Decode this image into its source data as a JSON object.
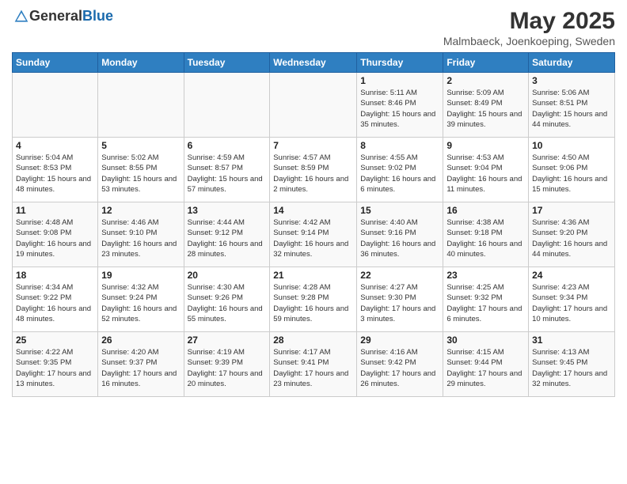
{
  "header": {
    "logo_general": "General",
    "logo_blue": "Blue",
    "title": "May 2025",
    "subtitle": "Malmbaeck, Joenkoeping, Sweden"
  },
  "days_of_week": [
    "Sunday",
    "Monday",
    "Tuesday",
    "Wednesday",
    "Thursday",
    "Friday",
    "Saturday"
  ],
  "weeks": [
    [
      {
        "day": "",
        "info": ""
      },
      {
        "day": "",
        "info": ""
      },
      {
        "day": "",
        "info": ""
      },
      {
        "day": "",
        "info": ""
      },
      {
        "day": "1",
        "info": "Sunrise: 5:11 AM\nSunset: 8:46 PM\nDaylight: 15 hours and 35 minutes."
      },
      {
        "day": "2",
        "info": "Sunrise: 5:09 AM\nSunset: 8:49 PM\nDaylight: 15 hours and 39 minutes."
      },
      {
        "day": "3",
        "info": "Sunrise: 5:06 AM\nSunset: 8:51 PM\nDaylight: 15 hours and 44 minutes."
      }
    ],
    [
      {
        "day": "4",
        "info": "Sunrise: 5:04 AM\nSunset: 8:53 PM\nDaylight: 15 hours and 48 minutes."
      },
      {
        "day": "5",
        "info": "Sunrise: 5:02 AM\nSunset: 8:55 PM\nDaylight: 15 hours and 53 minutes."
      },
      {
        "day": "6",
        "info": "Sunrise: 4:59 AM\nSunset: 8:57 PM\nDaylight: 15 hours and 57 minutes."
      },
      {
        "day": "7",
        "info": "Sunrise: 4:57 AM\nSunset: 8:59 PM\nDaylight: 16 hours and 2 minutes."
      },
      {
        "day": "8",
        "info": "Sunrise: 4:55 AM\nSunset: 9:02 PM\nDaylight: 16 hours and 6 minutes."
      },
      {
        "day": "9",
        "info": "Sunrise: 4:53 AM\nSunset: 9:04 PM\nDaylight: 16 hours and 11 minutes."
      },
      {
        "day": "10",
        "info": "Sunrise: 4:50 AM\nSunset: 9:06 PM\nDaylight: 16 hours and 15 minutes."
      }
    ],
    [
      {
        "day": "11",
        "info": "Sunrise: 4:48 AM\nSunset: 9:08 PM\nDaylight: 16 hours and 19 minutes."
      },
      {
        "day": "12",
        "info": "Sunrise: 4:46 AM\nSunset: 9:10 PM\nDaylight: 16 hours and 23 minutes."
      },
      {
        "day": "13",
        "info": "Sunrise: 4:44 AM\nSunset: 9:12 PM\nDaylight: 16 hours and 28 minutes."
      },
      {
        "day": "14",
        "info": "Sunrise: 4:42 AM\nSunset: 9:14 PM\nDaylight: 16 hours and 32 minutes."
      },
      {
        "day": "15",
        "info": "Sunrise: 4:40 AM\nSunset: 9:16 PM\nDaylight: 16 hours and 36 minutes."
      },
      {
        "day": "16",
        "info": "Sunrise: 4:38 AM\nSunset: 9:18 PM\nDaylight: 16 hours and 40 minutes."
      },
      {
        "day": "17",
        "info": "Sunrise: 4:36 AM\nSunset: 9:20 PM\nDaylight: 16 hours and 44 minutes."
      }
    ],
    [
      {
        "day": "18",
        "info": "Sunrise: 4:34 AM\nSunset: 9:22 PM\nDaylight: 16 hours and 48 minutes."
      },
      {
        "day": "19",
        "info": "Sunrise: 4:32 AM\nSunset: 9:24 PM\nDaylight: 16 hours and 52 minutes."
      },
      {
        "day": "20",
        "info": "Sunrise: 4:30 AM\nSunset: 9:26 PM\nDaylight: 16 hours and 55 minutes."
      },
      {
        "day": "21",
        "info": "Sunrise: 4:28 AM\nSunset: 9:28 PM\nDaylight: 16 hours and 59 minutes."
      },
      {
        "day": "22",
        "info": "Sunrise: 4:27 AM\nSunset: 9:30 PM\nDaylight: 17 hours and 3 minutes."
      },
      {
        "day": "23",
        "info": "Sunrise: 4:25 AM\nSunset: 9:32 PM\nDaylight: 17 hours and 6 minutes."
      },
      {
        "day": "24",
        "info": "Sunrise: 4:23 AM\nSunset: 9:34 PM\nDaylight: 17 hours and 10 minutes."
      }
    ],
    [
      {
        "day": "25",
        "info": "Sunrise: 4:22 AM\nSunset: 9:35 PM\nDaylight: 17 hours and 13 minutes."
      },
      {
        "day": "26",
        "info": "Sunrise: 4:20 AM\nSunset: 9:37 PM\nDaylight: 17 hours and 16 minutes."
      },
      {
        "day": "27",
        "info": "Sunrise: 4:19 AM\nSunset: 9:39 PM\nDaylight: 17 hours and 20 minutes."
      },
      {
        "day": "28",
        "info": "Sunrise: 4:17 AM\nSunset: 9:41 PM\nDaylight: 17 hours and 23 minutes."
      },
      {
        "day": "29",
        "info": "Sunrise: 4:16 AM\nSunset: 9:42 PM\nDaylight: 17 hours and 26 minutes."
      },
      {
        "day": "30",
        "info": "Sunrise: 4:15 AM\nSunset: 9:44 PM\nDaylight: 17 hours and 29 minutes."
      },
      {
        "day": "31",
        "info": "Sunrise: 4:13 AM\nSunset: 9:45 PM\nDaylight: 17 hours and 32 minutes."
      }
    ]
  ]
}
